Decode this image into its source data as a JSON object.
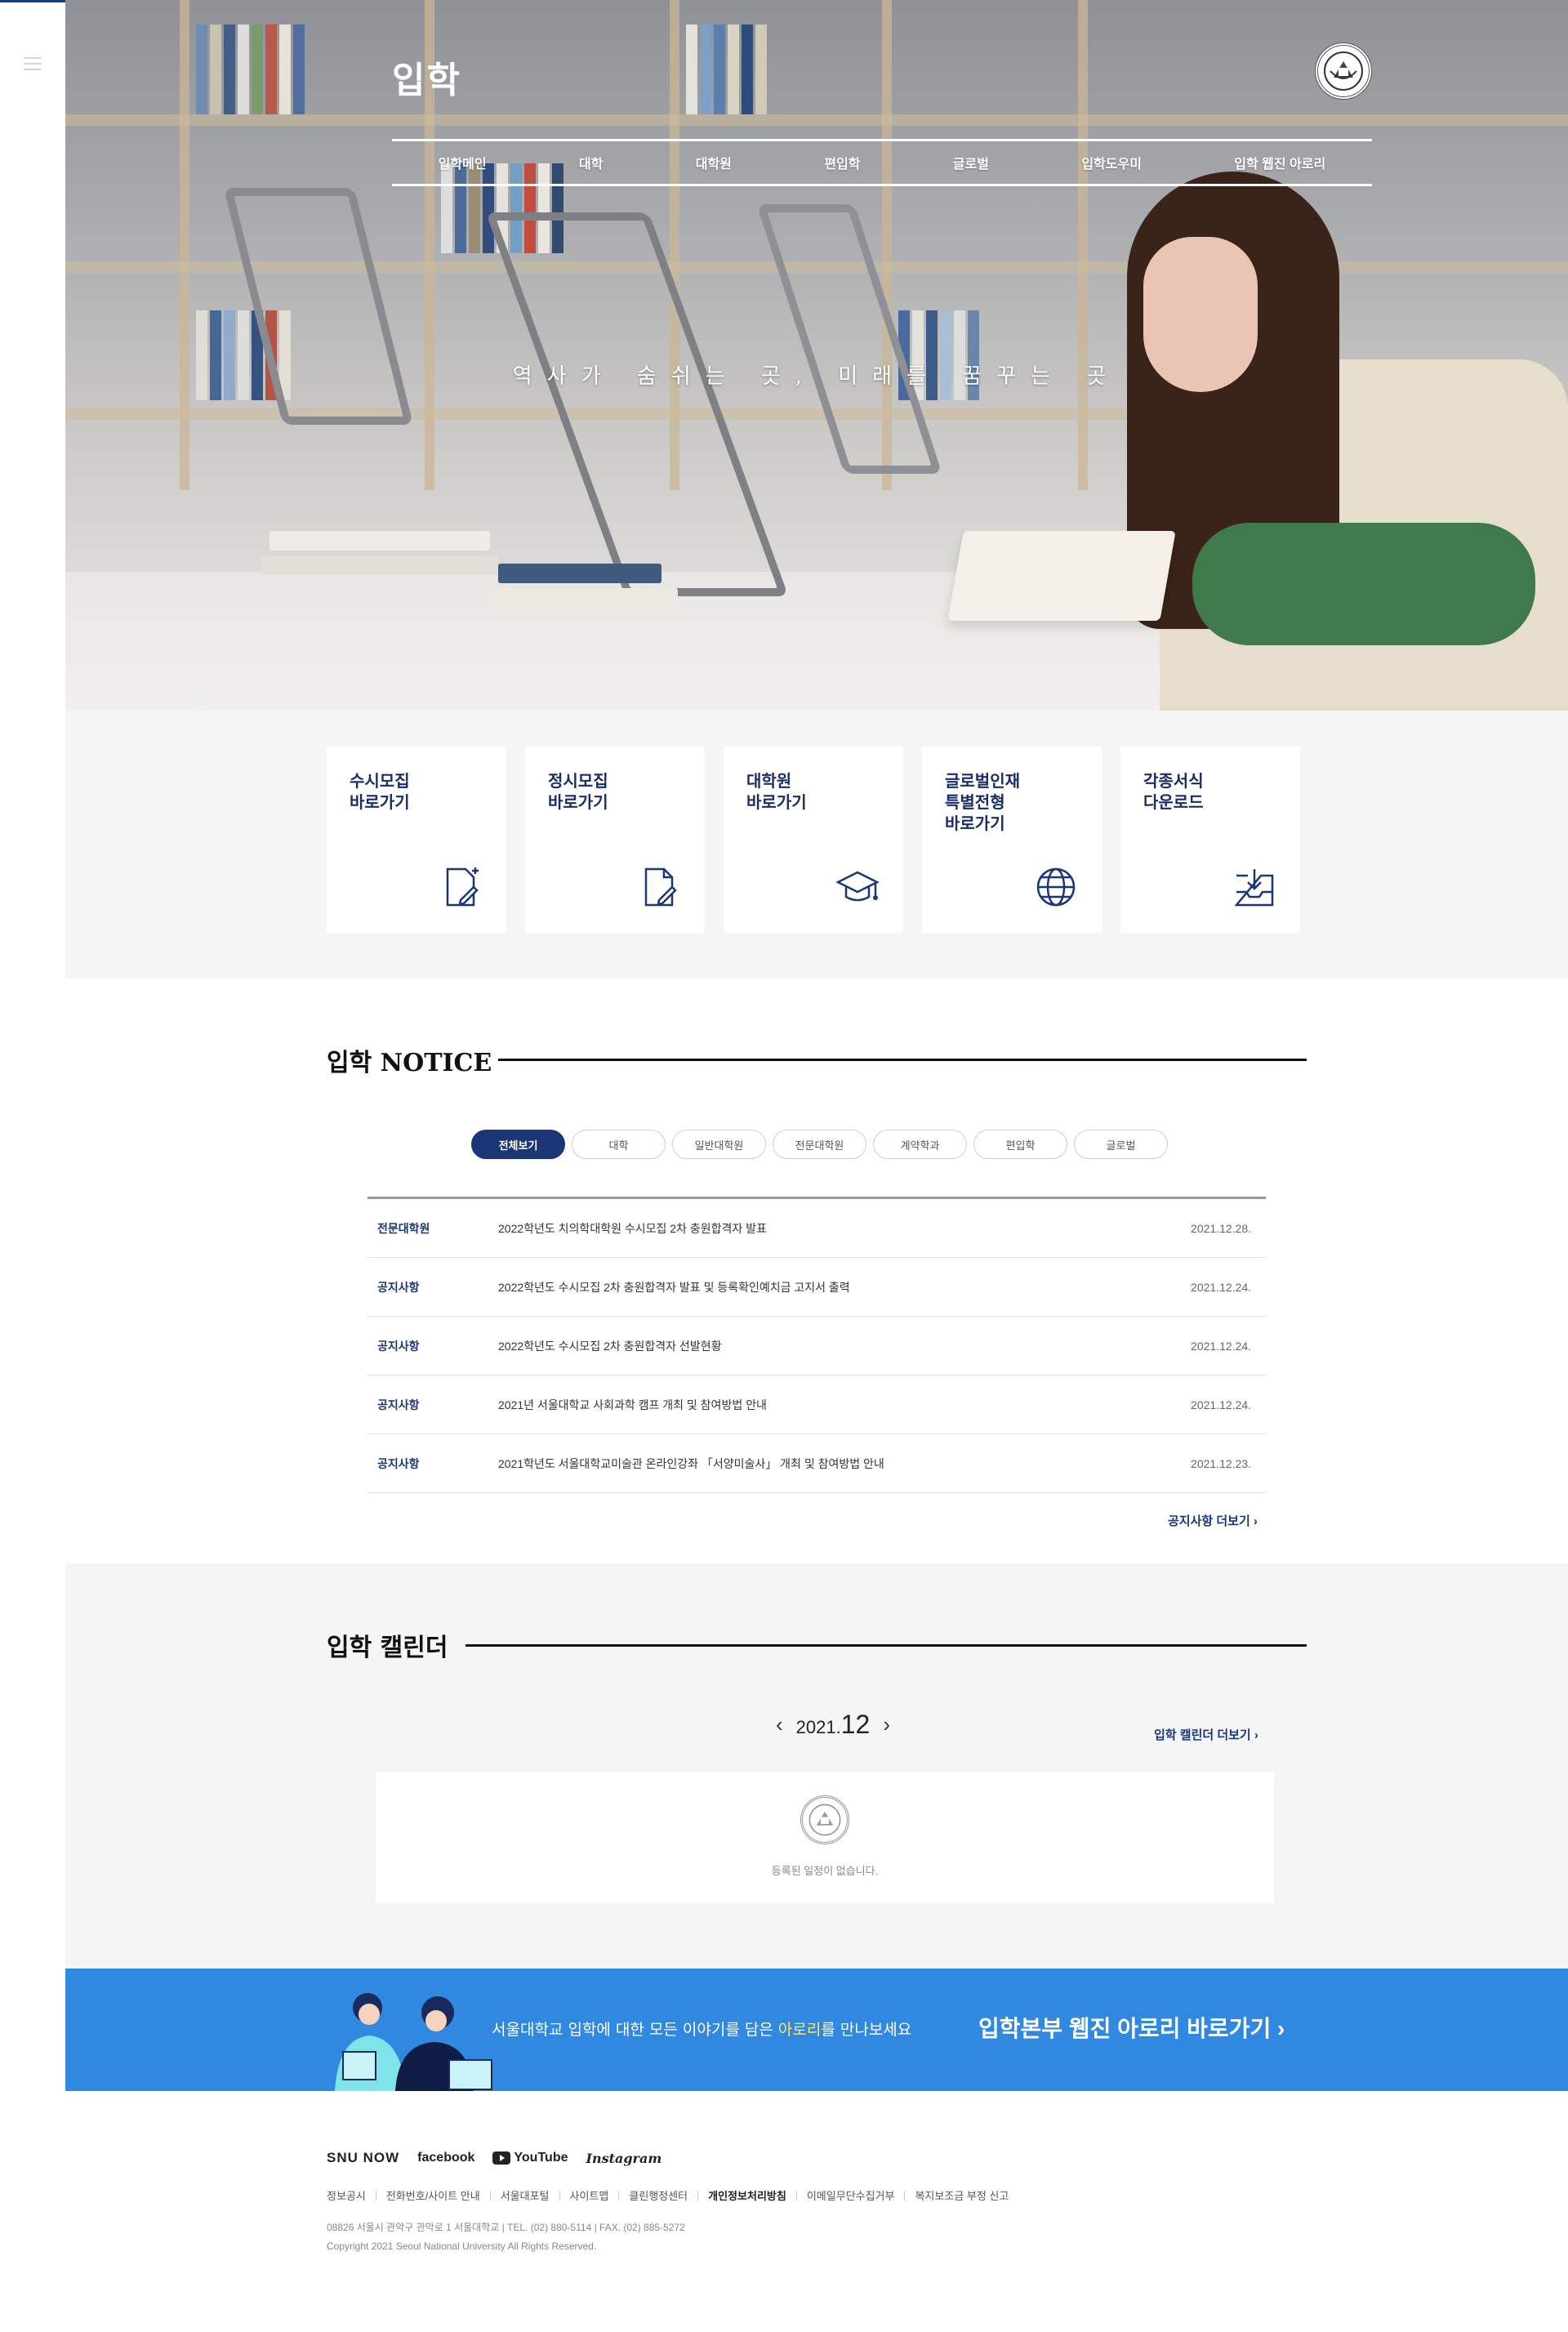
{
  "hero": {
    "title": "입학",
    "slogan": "역사가 숨쉬는 곳, 미래를 꿈꾸는 곳",
    "nav": [
      "입학메인",
      "대학",
      "대학원",
      "편입학",
      "글로벌",
      "입학도우미",
      "입학 웹진 아로리"
    ]
  },
  "quick_links": [
    {
      "label": "수시모집\n바로가기",
      "icon": "document-add-icon"
    },
    {
      "label": "정시모집\n바로가기",
      "icon": "document-edit-icon"
    },
    {
      "label": "대학원\n바로가기",
      "icon": "graduation-cap-icon"
    },
    {
      "label": "글로벌인재\n특별전형\n바로가기",
      "icon": "globe-icon"
    },
    {
      "label": "각종서식\n다운로드",
      "icon": "download-tray-icon"
    }
  ],
  "notice": {
    "title": "입학 NOTICE",
    "tabs": [
      "전체보기",
      "대학",
      "일반대학원",
      "전문대학원",
      "계약학과",
      "편입학",
      "글로벌"
    ],
    "active_tab": "전체보기",
    "rows": [
      {
        "category": "전문대학원",
        "title": "2022학년도 치의학대학원 수시모집 2차 충원합격자 발표",
        "date": "2021.12.28."
      },
      {
        "category": "공지사항",
        "title": "2022학년도 수시모집 2차 충원합격자 발표 및 등록확인예치금 고지서 출력",
        "date": "2021.12.24."
      },
      {
        "category": "공지사항",
        "title": "2022학년도 수시모집 2차 충원합격자 선발현황",
        "date": "2021.12.24."
      },
      {
        "category": "공지사항",
        "title": "2021년 서울대학교 사회과학 캠프 개최 및 참여방법 안내",
        "date": "2021.12.24."
      },
      {
        "category": "공지사항",
        "title": "2021학년도 서울대학교미술관 온라인강좌 「서양미술사」 개최 및 참여방법 안내",
        "date": "2021.12.23."
      }
    ],
    "more": "공지사항 더보기  ›"
  },
  "calendar": {
    "title": "입학 캘린더",
    "year": "2021.",
    "month": "12",
    "more": "입학 캘린더 더보기  ›",
    "empty_message": "등록된 일정이 없습니다."
  },
  "banner": {
    "text_before": "서울대학교 입학에 대한 모든 이야기를 담은 ",
    "highlight": "아로리",
    "text_after": "를 만나보세요",
    "cta": "입학본부 웹진 아로리 바로가기  ›",
    "color": "#3188e0"
  },
  "footer": {
    "sns": [
      "SNU NOW",
      "facebook",
      "YouTube",
      "Instagram"
    ],
    "links": [
      "정보공시",
      "전화번호/사이트 안내",
      "서울대포털",
      "사이트맵",
      "클린행정센터",
      "개인정보처리방침",
      "이메일무단수집거부",
      "복지보조금 부정 신고"
    ],
    "address": "08826 서울시 관악구 관악로 1 서울대학교  |  TEL. (02) 880-5114  |  FAX. (02) 885-5272",
    "copyright": "Copyright 2021 Seoul National University All Rights Reserved."
  },
  "colors": {
    "primary": "#1b3677",
    "accent_blue": "#3188e0",
    "highlight": "#ffe95a"
  }
}
